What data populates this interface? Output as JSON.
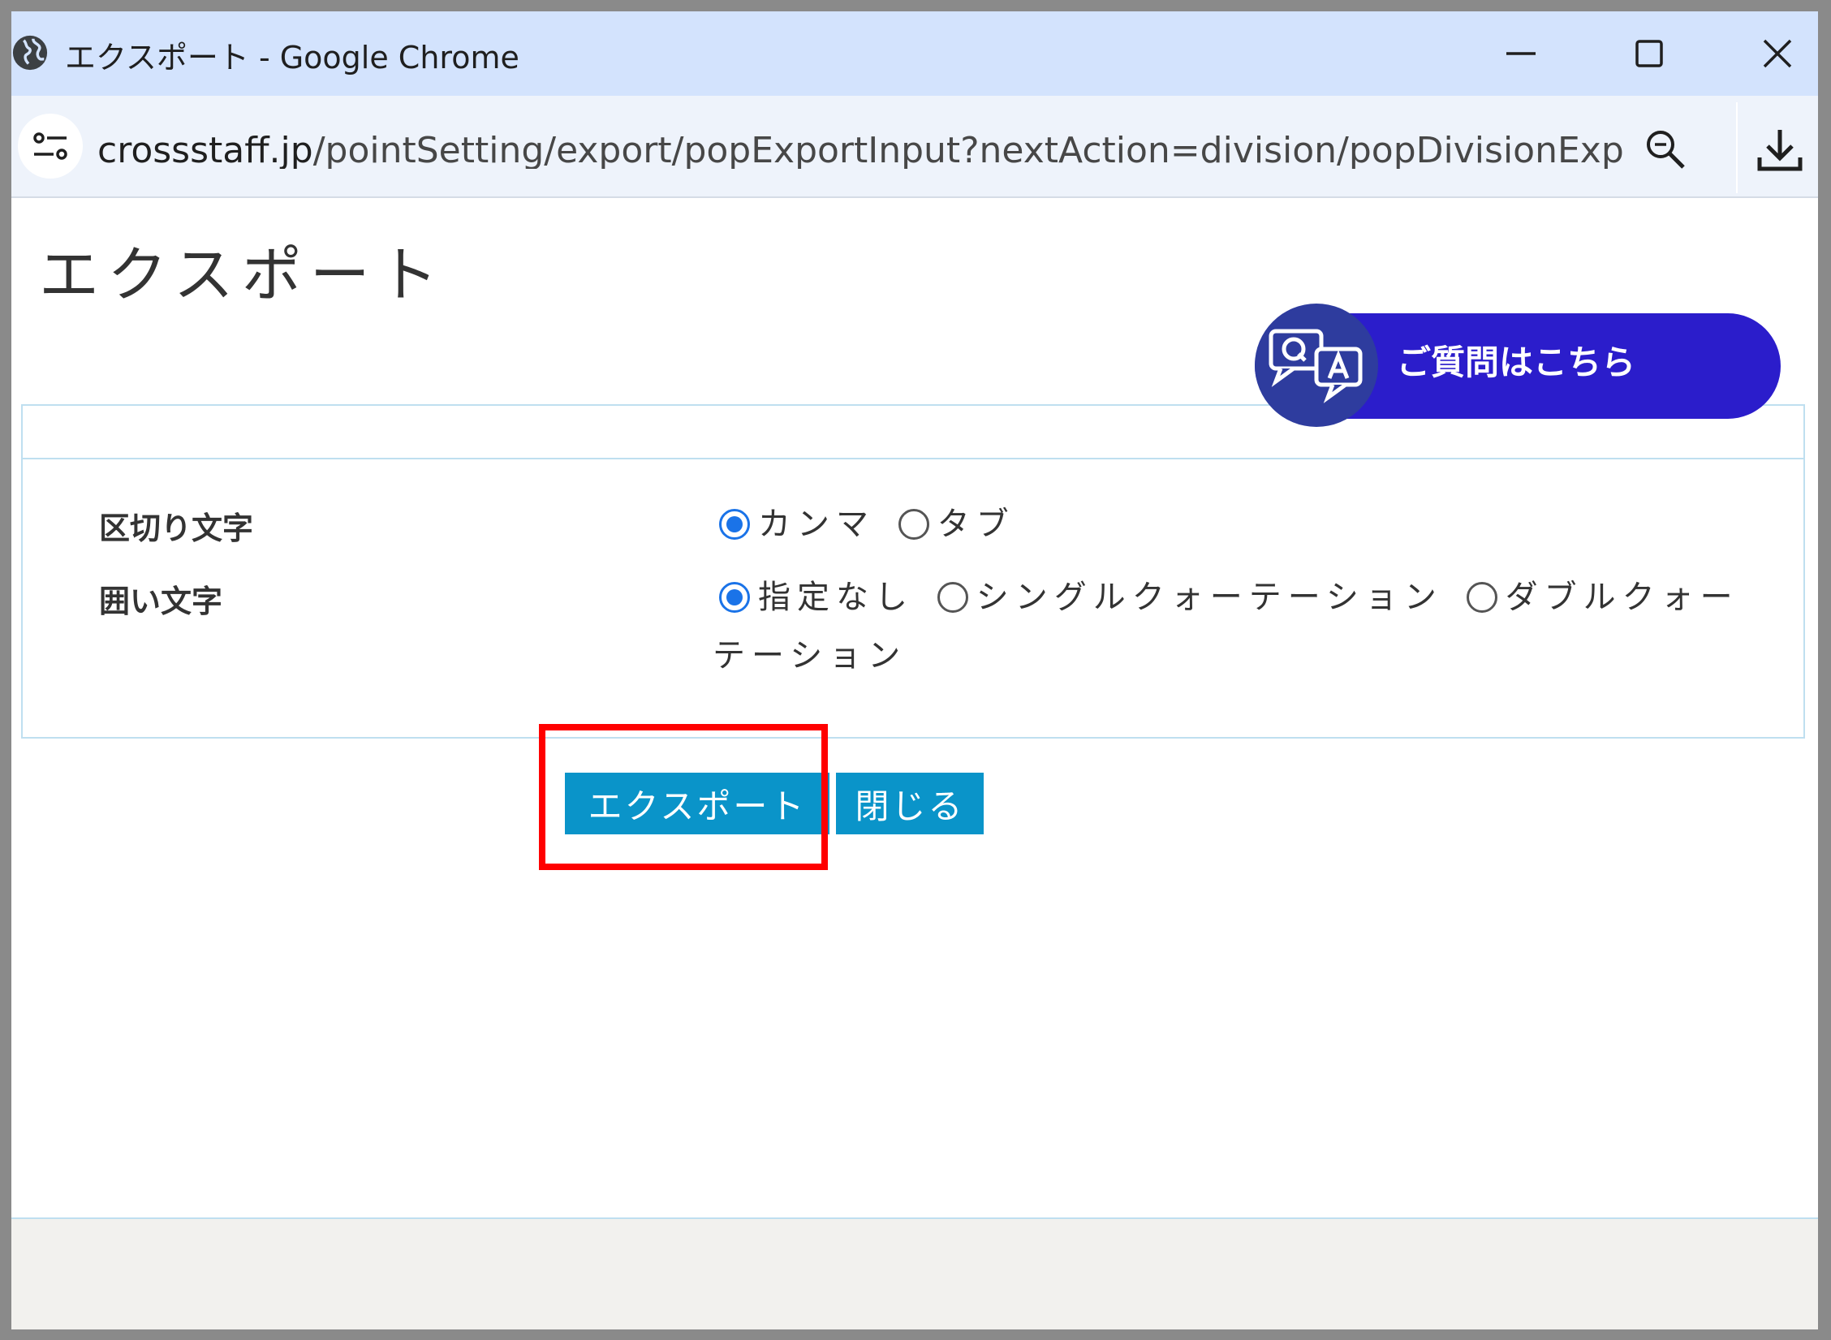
{
  "window": {
    "title": "エクスポート - Google Chrome"
  },
  "addressbar": {
    "url_host": "crossstaff.jp",
    "url_path": "/pointSetting/export/popExportInput?nextAction=division/popDivisionExp..."
  },
  "page": {
    "title": "エクスポート",
    "help_button_label": "ご質問はこちら"
  },
  "form": {
    "delimiter": {
      "label": "区切り文字",
      "options": [
        "カンマ",
        "タブ"
      ],
      "selected": "カンマ"
    },
    "enclosure": {
      "label": "囲い文字",
      "options": [
        "指定なし",
        "シングルクォーテーション",
        "ダブルクォーテーション"
      ],
      "selected": "指定なし"
    }
  },
  "actions": {
    "export_label": "エクスポート",
    "close_label": "閉じる"
  },
  "colors": {
    "titlebar": "#d3e3fd",
    "help_button": "#2b1dcb",
    "action_button": "#0a94c9",
    "highlight": "#ff0000",
    "radio_checked": "#1a73e8"
  }
}
